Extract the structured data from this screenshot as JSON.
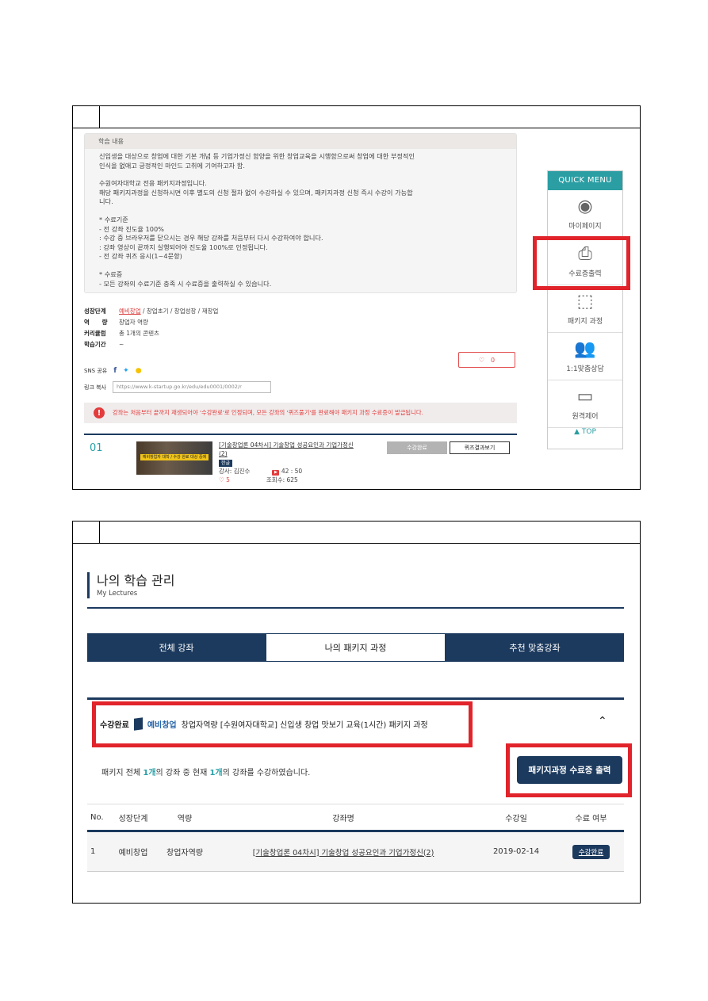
{
  "learning": {
    "heading": "학습 내용",
    "paragraphs": [
      "신입생을 대상으로 창업에 대한 기본 개념 등 기업가정신 함양을 위한 창업교육을 시행함으로써 창업에 대한 부정적인\n인식을 없애고 긍정적인 마인드 고취에 기여하고자 함.",
      "수원여자대학교 전용 패키지과정입니다.\n해당 패키지과정을 신청하시면 이후 별도의 신청 절차 없이 수강하실 수 있으며, 패키지과정 신청 즉시 수강이 가능합\n니다.",
      "* 수료기준\n- 전 강좌 진도율 100%\n: 수강 중 브라우저를 닫으시는 경우 해당 강좌를 처음부터 다시 수강하여야 합니다.\n: 강좌 영상이 끝까지 실행되어야 진도율 100%로 인정됩니다.\n- 전 강좌 퀴즈 응시(1~4문항)",
      "* 수료증\n- 모든 강좌의 수료기준 충족 시 수료증을 출력하실 수 있습니다."
    ]
  },
  "meta": {
    "stage_label": "성장단계",
    "stage_active": "예비창업",
    "stage_rest": " / 창업초기 / 창업성장 / 재창업",
    "capability_label": "역      량",
    "capability_value": "창업자 역량",
    "curriculum_label": "커리큘럼",
    "curriculum_value": "총 1개의 콘텐츠",
    "period_label": "학습기간",
    "period_value": "~"
  },
  "like": {
    "icon": "heart-outline",
    "count": "0"
  },
  "sns": {
    "label": "SNS 공유",
    "fb": "f",
    "tw": "🐦",
    "ks": "💬"
  },
  "link": {
    "label": "링크 복사",
    "url": "https://www.k-startup.go.kr/edu/edu0001/0002/r"
  },
  "alert": {
    "icon": "!",
    "text": "강좌는 처음부터 끝까지 재생되어야 '수강완료'로 인정되며, 모든 강좌의 '퀴즈풀기'를 완료해야 패키지 과정 수료증이 발급됩니다."
  },
  "course": {
    "no": "01",
    "thumb_caption": "예비창업자 대학 / 수강 완료 대상 중에",
    "title": "[기술창업론 04차시] 기술창업 성공요인과 기업가정신(2)",
    "badge": "한글",
    "instructor": "강사: 김진수",
    "duration": "42 : 50",
    "likes": "♡ 5",
    "views": "조회수: 625",
    "btn_done": "수강완료",
    "btn_quiz": "퀴즈결과보기"
  },
  "quick_menu": {
    "title": "QUICK MENU",
    "items": [
      "마이페이지",
      "수료증출력",
      "패키지 과정",
      "1:1맞춤상담",
      "원격제어"
    ],
    "top": "▲ TOP"
  },
  "my": {
    "title": "나의 학습 관리",
    "subtitle": "My Lectures",
    "tabs": [
      "전체 강좌",
      "나의 패키지 과정",
      "추천 맞춤강좌"
    ],
    "pkg_status": "수강완료",
    "pkg_stage": "예비창업",
    "pkg_title": "창업자역량 [수원여자대학교] 신입생 창업 맛보기 교육(1시간) 패키지 과정",
    "progress_pre": "패키지 전체 ",
    "progress_total": "1개",
    "progress_mid": "의 강좌 중 현재 ",
    "progress_done": "1개",
    "progress_post": "의 강좌를 수강하였습니다.",
    "print_button": "패키지과정 수료증 출력",
    "table_headers": [
      "No.",
      "성장단계",
      "역량",
      "강좌명",
      "수강일",
      "수료 여부"
    ],
    "rows": [
      {
        "no": "1",
        "stage": "예비창업",
        "cap": "창업자역량",
        "title": "[기술창업론 04차시] 기술창업 성공요인과 기업가정신(2)",
        "date": "2019-02-14",
        "done": "수강완료"
      }
    ]
  }
}
